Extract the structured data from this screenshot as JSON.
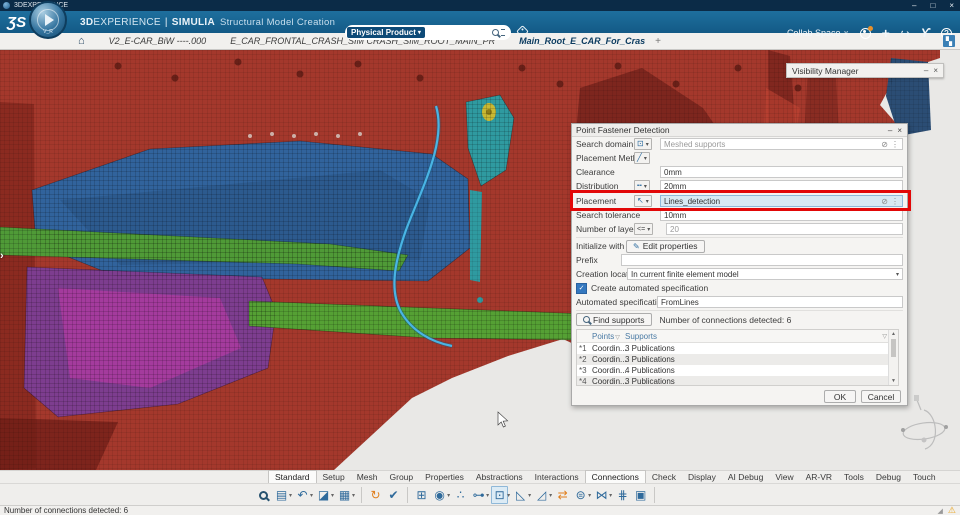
{
  "window": {
    "title": "3DEXPERIENCE"
  },
  "header": {
    "brand_bold": "3D",
    "brand_light": "EXPERIENCE",
    "separator": "|",
    "app_bold": "SIMULIA",
    "app_name": "Structural Model Creation",
    "search_scope": "Physical Product",
    "collab_label": "Collab Space",
    "compass_version": "V_R"
  },
  "file_tabs": {
    "tab1": "V2_E-CAR_BiW ----.000",
    "tab2": "E_CAR_FRONTAL_CRASH_SIM CRASH_SIM_ROOT_MAIN_PR",
    "tab3": "Main_Root_E_CAR_For_Cras",
    "add": "+"
  },
  "visibility_manager": {
    "title": "Visibility Manager"
  },
  "dialog": {
    "title": "Point Fastener Detection",
    "search_domain_label": "Search domain",
    "search_domain_placeholder": "Meshed supports",
    "placement_method_label": "Placement Method",
    "clearance_label": "Clearance",
    "clearance_value": "0mm",
    "distribution_label": "Distribution",
    "distribution_value": "20mm",
    "placement_label": "Placement",
    "placement_value": "Lines_detection",
    "search_tolerance_label": "Search tolerance",
    "search_tolerance_value": "10mm",
    "layers_label": "Number of layers",
    "layers_operator": "<=",
    "layers_value": "20",
    "initialize_label": "Initialize with",
    "edit_properties_button": "Edit properties",
    "prefix_label": "Prefix",
    "prefix_value": "",
    "creation_location_label": "Creation location",
    "creation_location_value": "In current finite element model",
    "auto_spec_checkbox_label": "Create automated specification",
    "auto_spec_name_label": "Automated specification name",
    "auto_spec_name_value": "FromLines",
    "find_supports_button": "Find supports",
    "detection_status": "Number of connections detected: 6",
    "table": {
      "col_points": "Points",
      "col_supports": "Supports",
      "rows": [
        {
          "id": "*1",
          "points": "Coordin...",
          "supports": "3 Publications"
        },
        {
          "id": "*2",
          "points": "Coordin...",
          "supports": "3 Publications"
        },
        {
          "id": "*3",
          "points": "Coordin...",
          "supports": "4 Publications"
        },
        {
          "id": "*4",
          "points": "Coordin...",
          "supports": "3 Publications"
        }
      ]
    },
    "ok_button": "OK",
    "cancel_button": "Cancel"
  },
  "action_bar": {
    "tabs": [
      "Standard",
      "Setup",
      "Mesh",
      "Group",
      "Properties",
      "Abstractions",
      "Interactions",
      "Connections",
      "Check",
      "Display",
      "AI Debug",
      "View",
      "AR-VR",
      "Tools",
      "Debug",
      "Touch"
    ],
    "active_tab": "Connections",
    "icons": [
      {
        "name": "catalogue-icon",
        "glyph": "▤"
      },
      {
        "name": "undo-icon",
        "glyph": "↶"
      },
      {
        "name": "selection-filter-icon",
        "glyph": "◪"
      },
      {
        "name": "grid-list-icon",
        "glyph": "▦"
      },
      {
        "name": "update-icon",
        "glyph": "↻"
      },
      {
        "name": "validate-icon",
        "glyph": "✔"
      },
      {
        "name": "frame-icon",
        "glyph": "⊞"
      },
      {
        "name": "probe-icon",
        "glyph": "◉"
      },
      {
        "name": "fastener-points-icon",
        "glyph": "∴"
      },
      {
        "name": "link-icon",
        "glyph": "⊶"
      },
      {
        "name": "point-fastener-detection-icon",
        "glyph": "⊡"
      },
      {
        "name": "seam-weld-icon",
        "glyph": "◺"
      },
      {
        "name": "surface-weld-icon",
        "glyph": "◿"
      },
      {
        "name": "swap-icon",
        "glyph": "⇄"
      },
      {
        "name": "rivet-icon",
        "glyph": "⊜"
      },
      {
        "name": "bolt-icon",
        "glyph": "⋈"
      },
      {
        "name": "coupling-icon",
        "glyph": "⋕"
      },
      {
        "name": "solid-box-icon",
        "glyph": "▣"
      }
    ]
  },
  "status_bar": {
    "message": "Number of connections detected: 6"
  },
  "icons": {
    "home": "⌂",
    "warning": "⚠",
    "help": "?",
    "add": "+",
    "share": "↪",
    "brand_y": "ϒ",
    "collab_caret": "∨",
    "minimize": "–",
    "maximize": "□",
    "close": "×",
    "filter": "▽",
    "scroll_up": "▲",
    "scroll_down": "▼",
    "caret": "▾",
    "check": "✓",
    "ellipsis": "⋮",
    "circle_slash": "⊘",
    "expand": "▚",
    "chevron_right": "›",
    "pencil": "✎",
    "combo_domain": "⊡",
    "combo_line": "╱",
    "combo_dash": "╍",
    "combo_cursor": "↖",
    "grip": "◢"
  },
  "colors": {
    "header_blue": "#16628f",
    "accent_blue": "#2d74a4",
    "highlight_red": "#e20808",
    "selected_field": "#d8e9f3",
    "warning": "#e8a21d",
    "mesh_red": "#a4382c",
    "panel_blue": "#31639c",
    "panel_purple": "#7d3d8f",
    "panel_green": "#4f9a37",
    "panel_teal": "#2f9aa0"
  }
}
